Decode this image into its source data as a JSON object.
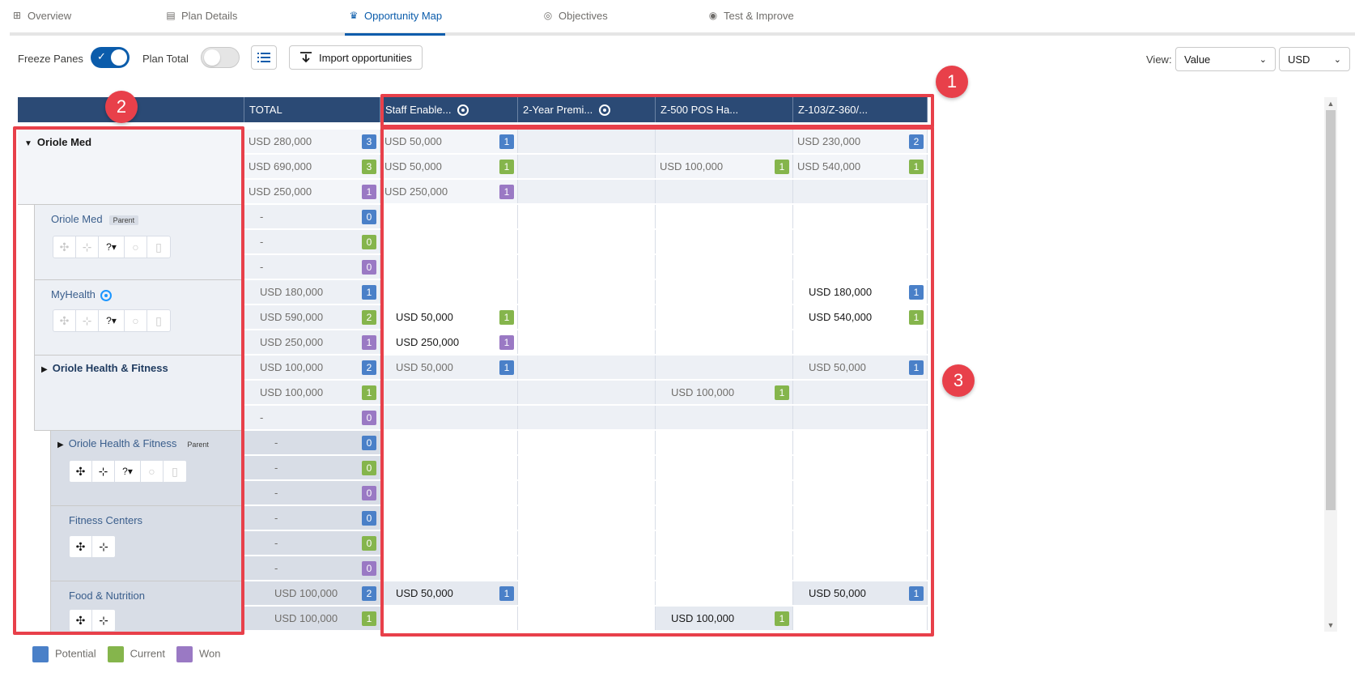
{
  "tabs": [
    {
      "label": "Overview",
      "icon": "grid-icon"
    },
    {
      "label": "Plan Details",
      "icon": "clipboard-icon"
    },
    {
      "label": "Opportunity Map",
      "icon": "crown-icon",
      "active": true
    },
    {
      "label": "Objectives",
      "icon": "target-icon"
    },
    {
      "label": "Test & Improve",
      "icon": "chart-icon"
    }
  ],
  "toolbar": {
    "freeze_panes_label": "Freeze Panes",
    "freeze_panes_on": true,
    "plan_total_label": "Plan Total",
    "plan_total_on": false,
    "import_label": "Import opportunities",
    "view_label": "View:",
    "view_value": "Value",
    "currency_value": "USD"
  },
  "columns": {
    "total": "TOTAL",
    "headers": [
      "Staff Enable...",
      "2-Year Premi...",
      "Z-500 POS Ha...",
      "Z-103/Z-360/..."
    ]
  },
  "orgs": {
    "oriole_med_top": "Oriole Med",
    "oriole_med_parent": "Oriole Med",
    "parent_badge": "Parent",
    "myhealth": "MyHealth",
    "ohf": "Oriole Health & Fitness",
    "ohf_parent": "Oriole Health & Fitness",
    "fitness_centers": "Fitness Centers",
    "food_nutrition": "Food & Nutrition",
    "question_mark": "?"
  },
  "rows": [
    {
      "total": "USD 280,000",
      "tb": "3",
      "c": [
        "USD 50,000",
        "",
        "",
        "USD 230,000"
      ],
      "cb": [
        "1",
        "",
        "",
        "2"
      ]
    },
    {
      "total": "USD 690,000",
      "tb": "3",
      "c": [
        "USD 50,000",
        "",
        "USD 100,000",
        "USD 540,000"
      ],
      "cb": [
        "1",
        "",
        "1",
        "1"
      ]
    },
    {
      "total": "USD 250,000",
      "tb": "1",
      "c": [
        "USD 250,000",
        "",
        "",
        ""
      ],
      "cb": [
        "1",
        "",
        "",
        ""
      ]
    },
    {
      "total": "-",
      "tb": "0",
      "c": [
        "",
        "",
        "",
        ""
      ],
      "cb": [
        "",
        "",
        "",
        ""
      ]
    },
    {
      "total": "-",
      "tb": "0",
      "c": [
        "",
        "",
        "",
        ""
      ],
      "cb": [
        "",
        "",
        "",
        ""
      ]
    },
    {
      "total": "-",
      "tb": "0",
      "c": [
        "",
        "",
        "",
        ""
      ],
      "cb": [
        "",
        "",
        "",
        ""
      ]
    },
    {
      "total": "USD 180,000",
      "tb": "1",
      "c": [
        "",
        "",
        "",
        "USD 180,000"
      ],
      "cb": [
        "",
        "",
        "",
        "1"
      ]
    },
    {
      "total": "USD 590,000",
      "tb": "2",
      "c": [
        "USD 50,000",
        "",
        "",
        "USD 540,000"
      ],
      "cb": [
        "1",
        "",
        "",
        "1"
      ]
    },
    {
      "total": "USD 250,000",
      "tb": "1",
      "c": [
        "USD 250,000",
        "",
        "",
        ""
      ],
      "cb": [
        "1",
        "",
        "",
        ""
      ]
    },
    {
      "total": "USD 100,000",
      "tb": "2",
      "c": [
        "USD 50,000",
        "",
        "",
        "USD 50,000"
      ],
      "cb": [
        "1",
        "",
        "",
        "1"
      ]
    },
    {
      "total": "USD 100,000",
      "tb": "1",
      "c": [
        "",
        "",
        "USD 100,000",
        ""
      ],
      "cb": [
        "",
        "",
        "1",
        ""
      ]
    },
    {
      "total": "-",
      "tb": "0",
      "c": [
        "",
        "",
        "",
        ""
      ],
      "cb": [
        "",
        "",
        "",
        ""
      ]
    },
    {
      "total": "-",
      "tb": "0",
      "c": [
        "",
        "",
        "",
        ""
      ],
      "cb": [
        "",
        "",
        "",
        ""
      ]
    },
    {
      "total": "-",
      "tb": "0",
      "c": [
        "",
        "",
        "",
        ""
      ],
      "cb": [
        "",
        "",
        "",
        ""
      ]
    },
    {
      "total": "-",
      "tb": "0",
      "c": [
        "",
        "",
        "",
        ""
      ],
      "cb": [
        "",
        "",
        "",
        ""
      ]
    },
    {
      "total": "-",
      "tb": "0",
      "c": [
        "",
        "",
        "",
        ""
      ],
      "cb": [
        "",
        "",
        "",
        ""
      ]
    },
    {
      "total": "-",
      "tb": "0",
      "c": [
        "",
        "",
        "",
        ""
      ],
      "cb": [
        "",
        "",
        "",
        ""
      ]
    },
    {
      "total": "-",
      "tb": "0",
      "c": [
        "",
        "",
        "",
        ""
      ],
      "cb": [
        "",
        "",
        "",
        ""
      ]
    },
    {
      "total": "USD 100,000",
      "tb": "2",
      "c": [
        "USD 50,000",
        "",
        "",
        "USD 50,000"
      ],
      "cb": [
        "1",
        "",
        "",
        "1"
      ]
    },
    {
      "total": "USD 100,000",
      "tb": "1",
      "c": [
        "",
        "",
        "USD 100,000",
        ""
      ],
      "cb": [
        "",
        "",
        "1",
        ""
      ]
    }
  ],
  "legend": [
    {
      "label": "Potential",
      "color": "#4a80c8"
    },
    {
      "label": "Current",
      "color": "#85b54c"
    },
    {
      "label": "Won",
      "color": "#9a79c4"
    }
  ],
  "annotations": [
    "1",
    "2",
    "3"
  ],
  "colors": {
    "header_bg": "#2b4a75",
    "accent": "#0b5cab",
    "annotation_red": "#e8404a"
  }
}
